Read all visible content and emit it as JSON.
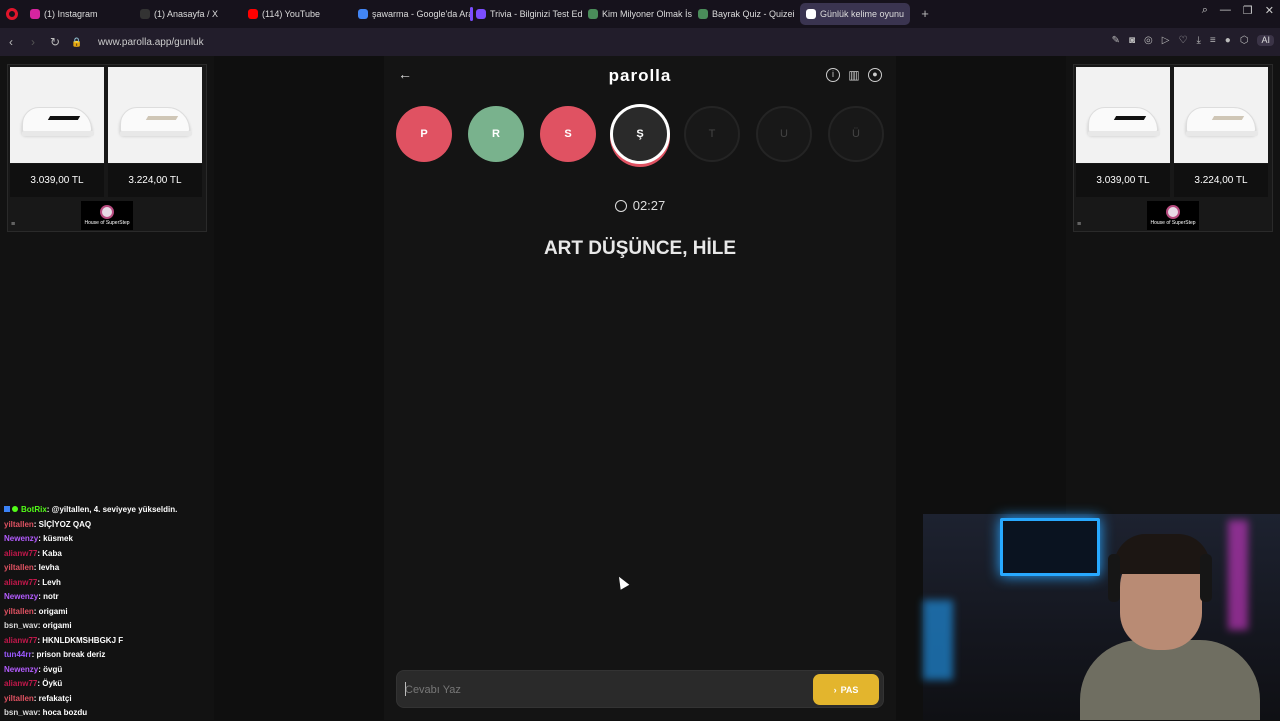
{
  "browser": {
    "tabs": [
      {
        "label": "(1) Instagram",
        "icon": "instagram-icon",
        "color": "#d6249f"
      },
      {
        "label": "(1) Anasayfa / X",
        "icon": "x-icon",
        "color": "#333333"
      },
      {
        "label": "(114) YouTube",
        "icon": "youtube-icon",
        "color": "#ff0000"
      },
      {
        "label": "şawarma - Google'da Ara",
        "icon": "google-icon",
        "color": "#4285f4"
      },
      {
        "label": "Trivia - Bilginizi Test Edin",
        "icon": "trivia-icon",
        "color": "#7b4dff"
      },
      {
        "label": "Kim Milyoner Olmak İster",
        "icon": "quiz-icon",
        "color": "#4a8c5a"
      },
      {
        "label": "Bayrak Quiz - Quizei",
        "icon": "quiz-icon",
        "color": "#4a8c5a"
      },
      {
        "label": "Günlük kelime oyunu",
        "icon": "parolla-icon",
        "color": "#ffffff",
        "active": true
      }
    ],
    "url": "www.parolla.app/gunluk"
  },
  "ads": {
    "left": {
      "products": [
        {
          "price": "3.039,00 TL"
        },
        {
          "price": "3.224,00 TL"
        }
      ],
      "brand": "House of SuperStep"
    },
    "right": {
      "products": [
        {
          "price": "3.039,00 TL"
        },
        {
          "price": "3.224,00 TL"
        }
      ],
      "brand": "House of SuperStep"
    }
  },
  "game": {
    "logo": "parolla",
    "letters": [
      {
        "char": "P",
        "state": "wrong"
      },
      {
        "char": "R",
        "state": "right"
      },
      {
        "char": "S",
        "state": "wrong"
      },
      {
        "char": "Ş",
        "state": "current"
      },
      {
        "char": "T",
        "state": "pending"
      },
      {
        "char": "U",
        "state": "pending"
      },
      {
        "char": "Ü",
        "state": "pending"
      }
    ],
    "timer": "02:27",
    "clue": "ART DÜŞÜNCE, HİLE",
    "answer_placeholder": "Cevabı Yaz",
    "pass_label": "PAS",
    "colors": {
      "wrong": "#e05262",
      "right": "#79b28d",
      "pass": "#e3b52d"
    }
  },
  "chat": [
    {
      "user": "BotRix",
      "msg": ": @yiltallen, 4. seviyeye yükseldin.",
      "color": "#53fc18",
      "badges": true
    },
    {
      "user": "yiltallen",
      "msg": ": SİÇİYOZ QAQ",
      "color": "#e05262"
    },
    {
      "user": "Newenzy",
      "msg": ": küsmek",
      "color": "#b45cff"
    },
    {
      "user": "alianw77",
      "msg": ": Kaba",
      "color": "#c2184b"
    },
    {
      "user": "yiltallen",
      "msg": ": levha",
      "color": "#e05262"
    },
    {
      "user": "alianw77",
      "msg": ": Levh",
      "color": "#c2184b"
    },
    {
      "user": "Newenzy",
      "msg": ": notr",
      "color": "#b45cff"
    },
    {
      "user": "yiltallen",
      "msg": ": origami",
      "color": "#e05262"
    },
    {
      "user": "bsn_wav",
      "msg": ": origami",
      "color": "#dddddd"
    },
    {
      "user": "alianw77",
      "msg": ": HKNLDKMSHBGKJ F",
      "color": "#c2184b"
    },
    {
      "user": "tun44rr",
      "msg": ": prison break deriz",
      "color": "#9b59ff"
    },
    {
      "user": "Newenzy",
      "msg": ": övgü",
      "color": "#b45cff"
    },
    {
      "user": "alianw77",
      "msg": ": Öykü",
      "color": "#c2184b"
    },
    {
      "user": "yiltallen",
      "msg": ": refakatçi",
      "color": "#e05262"
    },
    {
      "user": "bsn_wav",
      "msg": ": hoca bozdu",
      "color": "#dddddd"
    }
  ]
}
